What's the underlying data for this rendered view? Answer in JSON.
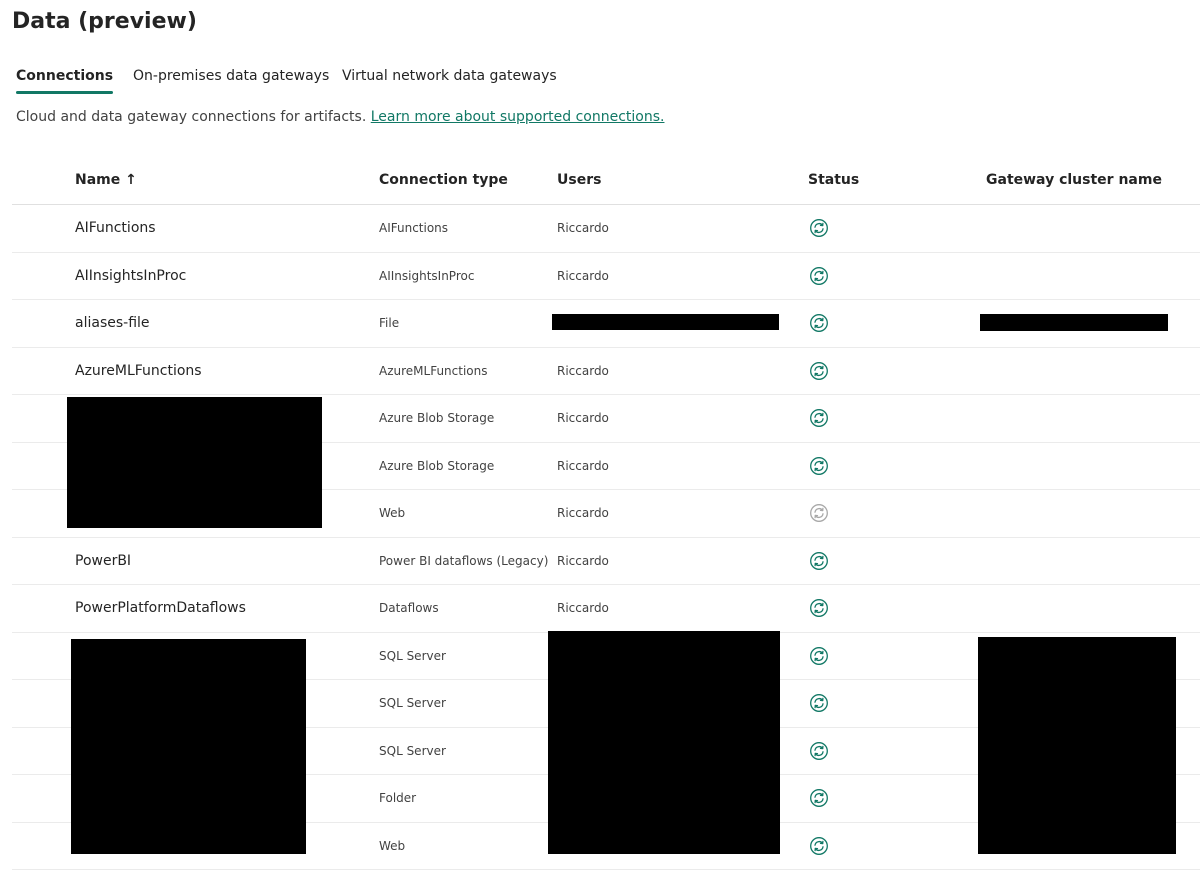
{
  "page": {
    "title": "Data (preview)"
  },
  "tabs": [
    {
      "label": "Connections",
      "active": true
    },
    {
      "label": "On-premises data gateways",
      "active": false
    },
    {
      "label": "Virtual network data gateways",
      "active": false
    }
  ],
  "description": {
    "text": "Cloud and data gateway connections for artifacts. ",
    "link": "Learn more about supported connections."
  },
  "table": {
    "columns": {
      "name": "Name ↑",
      "type": "Connection type",
      "users": "Users",
      "status": "Status",
      "gateway": "Gateway cluster name"
    },
    "rows": [
      {
        "name": "AIFunctions",
        "type": "AIFunctions",
        "users": "Riccardo",
        "status": "online"
      },
      {
        "name": "AIInsightsInProc",
        "type": "AIInsightsInProc",
        "users": "Riccardo",
        "status": "online"
      },
      {
        "name": "aliases-file",
        "type": "File",
        "users": "",
        "status": "online"
      },
      {
        "name": "AzureMLFunctions",
        "type": "AzureMLFunctions",
        "users": "Riccardo",
        "status": "online"
      },
      {
        "name": "",
        "type": "Azure Blob Storage",
        "users": "Riccardo",
        "status": "online"
      },
      {
        "name": "",
        "type": "Azure Blob Storage",
        "users": "Riccardo",
        "status": "online"
      },
      {
        "name": "",
        "type": "Web",
        "users": "Riccardo",
        "status": "disabled"
      },
      {
        "name": "PowerBI",
        "type": "Power BI dataflows (Legacy)",
        "users": "Riccardo",
        "status": "online"
      },
      {
        "name": "PowerPlatformDataflows",
        "type": "Dataflows",
        "users": "Riccardo",
        "status": "online"
      },
      {
        "name": "..",
        "type": "SQL Server",
        "users": "",
        "status": "online"
      },
      {
        "name": "",
        "type": "SQL Server",
        "users": "",
        "status": "online"
      },
      {
        "name": "",
        "type": "SQL Server",
        "users": "",
        "status": "online"
      },
      {
        "name": "",
        "type": "Folder",
        "users": "",
        "status": "online"
      },
      {
        "name": "",
        "type": "Web",
        "users": "",
        "status": "online"
      }
    ]
  },
  "colors": {
    "accent": "#117865",
    "status_online": "#117865",
    "status_disabled": "#a8a8a8"
  },
  "icons": {
    "status": "refresh-cycle-icon"
  }
}
